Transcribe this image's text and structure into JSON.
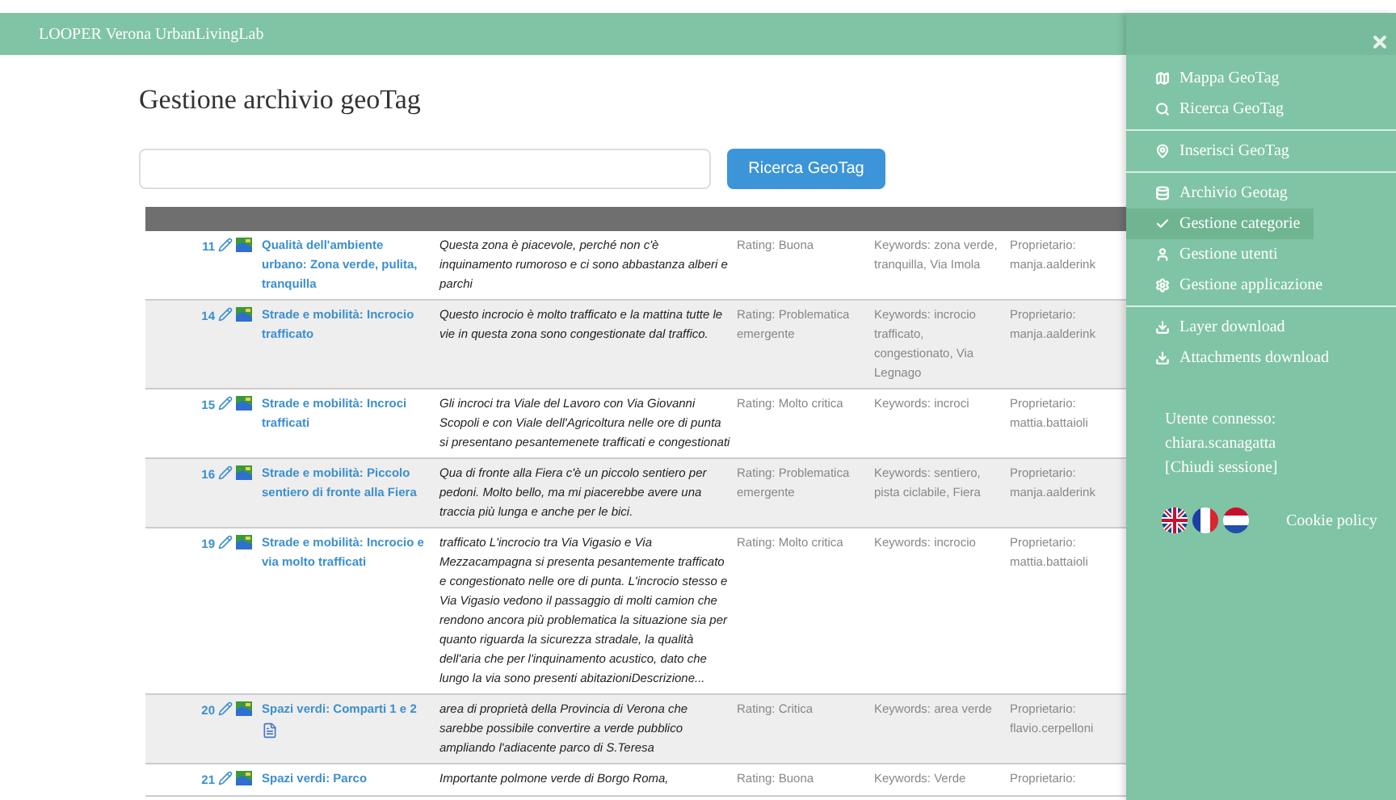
{
  "navbar": {
    "title": "LOOPER Verona UrbanLivingLab"
  },
  "page_title": "Gestione archivio geoTag",
  "search": {
    "button": "Ricerca GeoTag"
  },
  "table": {
    "rows": [
      {
        "id": "11",
        "title": "Qualità dell'ambiente urbano: Zona verde, pulita, tranquilla",
        "description": "Questa zona è piacevole, perché non c'è inquinamento rumoroso e ci sono abbastanza alberi e parchi",
        "rating": "Rating: Buona",
        "keywords": "Keywords: zona verde, tranquilla, Via Imola",
        "owner": "Proprietario: manja.aalderink",
        "attachment": false
      },
      {
        "id": "14",
        "title": "Strade e mobilità: Incrocio trafficato",
        "description": "Questo incrocio è molto trafficato e la mattina tutte le vie in questa zona sono congestionate dal traffico.",
        "rating": "Rating: Problematica emergente",
        "keywords": "Keywords: incrocio trafficato, congestionato, Via Legnago",
        "owner": "Proprietario: manja.aalderink",
        "attachment": false
      },
      {
        "id": "15",
        "title": "Strade e mobilità: Incroci trafficati",
        "description": "Gli incroci tra Viale del Lavoro con Via Giovanni Scopoli e con Viale dell'Agricoltura nelle ore di punta si presentano pesantemenete trafficati e congestionati",
        "rating": "Rating: Molto critica",
        "keywords": "Keywords: incroci",
        "owner": "Proprietario: mattia.battaioli",
        "attachment": false
      },
      {
        "id": "16",
        "title": "Strade e mobilità: Piccolo sentiero di fronte alla Fiera",
        "description": "Qua di fronte alla Fiera c'è un piccolo sentiero per pedoni. Molto bello, ma mi piacerebbe avere una traccia più lunga e anche per le bici.",
        "rating": "Rating: Problematica emergente",
        "keywords": "Keywords: sentiero, pista ciclabile, Fiera",
        "owner": "Proprietario: manja.aalderink",
        "attachment": false
      },
      {
        "id": "19",
        "title": "Strade e mobilità: Incrocio e via molto trafficati",
        "description": "trafficato L'incrocio tra Via Vigasio e Via Mezzacampagna si presenta pesantemente trafficato e congestionato nelle ore di punta. L'incrocio stesso e Via Vigasio vedono il passaggio di molti camion che rendono ancora più problematica la situazione sia per quanto riguarda la sicurezza stradale, la qualità dell'aria che per l'inquinamento acustico, dato che lungo la via sono presenti abitazioniDescrizione...",
        "rating": "Rating: Molto critica",
        "keywords": "Keywords: incrocio",
        "owner": "Proprietario: mattia.battaioli",
        "attachment": false
      },
      {
        "id": "20",
        "title": "Spazi verdi: Comparti 1 e 2",
        "description": "area di proprietà della Provincia di Verona che sarebbe possibile convertire a verde pubblico ampliando l'adiacente parco di S.Teresa",
        "rating": "Rating: Critica",
        "keywords": "Keywords: area verde",
        "owner": "Proprietario: flavio.cerpelloni",
        "attachment": true
      },
      {
        "id": "21",
        "title": "Spazi verdi: Parco",
        "description": "Importante polmone verde di Borgo Roma,",
        "rating": "Rating: Buona",
        "keywords": "Keywords: Verde",
        "owner": "Proprietario:",
        "attachment": false
      }
    ]
  },
  "menu": {
    "sections": [
      [
        {
          "label": "Mappa GeoTag",
          "kind": "map",
          "selected": false
        },
        {
          "label": "Ricerca GeoTag",
          "kind": "search",
          "selected": false
        }
      ],
      [
        {
          "label": "Inserisci GeoTag",
          "kind": "pin",
          "selected": false
        }
      ],
      [
        {
          "label": "Archivio Geotag",
          "kind": "database",
          "selected": false
        },
        {
          "label": "Gestione categorie",
          "kind": "check",
          "selected": true
        },
        {
          "label": "Gestione utenti",
          "kind": "user",
          "selected": false
        },
        {
          "label": "Gestione applicazione",
          "kind": "gear",
          "selected": false
        }
      ],
      [
        {
          "label": "Layer download",
          "kind": "download",
          "selected": false
        },
        {
          "label": "Attachments download",
          "kind": "download",
          "selected": false
        }
      ]
    ],
    "user_label": "Utente connesso:",
    "user": "chiara.scanagatta",
    "logout": "[Chiudi sessione]",
    "languages": [
      {
        "kind": "uk"
      },
      {
        "kind": "fr"
      },
      {
        "kind": "nl"
      }
    ],
    "cookie": "Cookie policy"
  }
}
